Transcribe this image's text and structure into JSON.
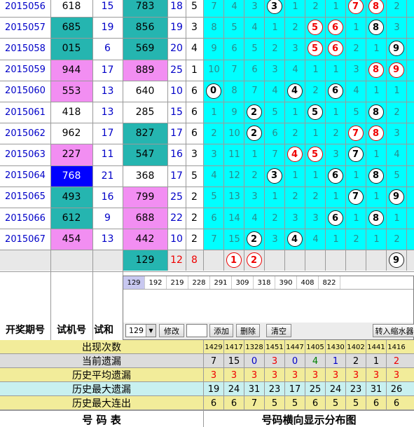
{
  "rows": [
    {
      "period": "2015056",
      "test": "618",
      "ts": "15",
      "num": "783",
      "sum": "18",
      "span": "5",
      "balls": [
        {
          "d": "3",
          "c": "black"
        },
        {
          "d": "7",
          "c": "red"
        },
        {
          "d": "8",
          "c": "red"
        }
      ],
      "misses": [
        "7",
        "4",
        "3",
        "",
        "1",
        "2",
        "1",
        "",
        "",
        "2"
      ]
    },
    {
      "period": "2015057",
      "test": "685",
      "ts": "19",
      "num": "856",
      "sum": "19",
      "span": "3",
      "balls": [
        {
          "d": "5",
          "c": "red"
        },
        {
          "d": "6",
          "c": "red"
        },
        {
          "d": "8",
          "c": "black"
        }
      ],
      "misses": [
        "8",
        "5",
        "4",
        "1",
        "2",
        "",
        "",
        "1",
        "",
        "3"
      ]
    },
    {
      "period": "2015058",
      "test": "015",
      "ts": "6",
      "num": "569",
      "sum": "20",
      "span": "4",
      "balls": [
        {
          "d": "5",
          "c": "red"
        },
        {
          "d": "6",
          "c": "red"
        },
        {
          "d": "9",
          "c": "black"
        }
      ],
      "misses": [
        "9",
        "6",
        "5",
        "2",
        "3",
        "",
        "",
        "2",
        "1",
        ""
      ]
    },
    {
      "period": "2015059",
      "test": "944",
      "ts": "17",
      "num": "889",
      "sum": "25",
      "span": "1",
      "balls": [
        {
          "d": "8",
          "c": "red"
        },
        {
          "d": "9",
          "c": "red"
        }
      ],
      "misses": [
        "10",
        "7",
        "6",
        "3",
        "4",
        "1",
        "1",
        "3",
        "",
        ""
      ]
    },
    {
      "period": "2015060",
      "test": "553",
      "ts": "13",
      "num": "640",
      "sum": "10",
      "span": "6",
      "balls": [
        {
          "d": "0",
          "c": "black"
        },
        {
          "d": "4",
          "c": "black"
        },
        {
          "d": "6",
          "c": "black"
        }
      ],
      "misses": [
        "",
        "8",
        "7",
        "4",
        "",
        "2",
        "",
        "4",
        "1",
        "1"
      ]
    },
    {
      "period": "2015061",
      "test": "418",
      "ts": "13",
      "num": "285",
      "sum": "15",
      "span": "6",
      "balls": [
        {
          "d": "2",
          "c": "black"
        },
        {
          "d": "5",
          "c": "black"
        },
        {
          "d": "8",
          "c": "black"
        }
      ],
      "misses": [
        "1",
        "9",
        "",
        "5",
        "1",
        "",
        "1",
        "5",
        "",
        "2"
      ]
    },
    {
      "period": "2015062",
      "test": "962",
      "ts": "17",
      "num": "827",
      "sum": "17",
      "span": "6",
      "balls": [
        {
          "d": "2",
          "c": "black"
        },
        {
          "d": "7",
          "c": "red"
        },
        {
          "d": "8",
          "c": "red"
        }
      ],
      "misses": [
        "2",
        "10",
        "",
        "6",
        "2",
        "1",
        "2",
        "",
        "",
        "3"
      ]
    },
    {
      "period": "2015063",
      "test": "227",
      "ts": "11",
      "num": "547",
      "sum": "16",
      "span": "3",
      "balls": [
        {
          "d": "4",
          "c": "red"
        },
        {
          "d": "5",
          "c": "red"
        },
        {
          "d": "7",
          "c": "black"
        }
      ],
      "misses": [
        "3",
        "11",
        "1",
        "7",
        "",
        "",
        "3",
        "",
        "1",
        "4"
      ]
    },
    {
      "period": "2015064",
      "test": "768",
      "ts": "21",
      "num": "368",
      "sum": "17",
      "span": "5",
      "balls": [
        {
          "d": "3",
          "c": "black"
        },
        {
          "d": "6",
          "c": "black"
        },
        {
          "d": "8",
          "c": "black"
        }
      ],
      "misses": [
        "4",
        "12",
        "2",
        "",
        "1",
        "1",
        "",
        "1",
        "",
        "5"
      ]
    },
    {
      "period": "2015065",
      "test": "493",
      "ts": "16",
      "num": "799",
      "sum": "25",
      "span": "2",
      "balls": [
        {
          "d": "7",
          "c": "black"
        },
        {
          "d": "9",
          "c": "black"
        }
      ],
      "misses": [
        "5",
        "13",
        "3",
        "1",
        "2",
        "2",
        "1",
        "",
        "1",
        ""
      ]
    },
    {
      "period": "2015066",
      "test": "612",
      "ts": "9",
      "num": "688",
      "sum": "22",
      "span": "2",
      "balls": [
        {
          "d": "6",
          "c": "black"
        },
        {
          "d": "8",
          "c": "black"
        }
      ],
      "misses": [
        "6",
        "14",
        "4",
        "2",
        "3",
        "3",
        "",
        "1",
        "",
        "1"
      ]
    },
    {
      "period": "2015067",
      "test": "454",
      "ts": "13",
      "num": "442",
      "sum": "10",
      "span": "2",
      "balls": [
        {
          "d": "2",
          "c": "black"
        },
        {
          "d": "4",
          "c": "black"
        }
      ],
      "misses": [
        "7",
        "15",
        "",
        "3",
        "",
        "4",
        "1",
        "2",
        "1",
        "2"
      ]
    }
  ],
  "forecast": {
    "num": "129",
    "sum": "12",
    "span": "8",
    "balls": [
      {
        "d": "1",
        "c": "red"
      },
      {
        "d": "2",
        "c": "red"
      },
      {
        "d": "9",
        "c": "black"
      }
    ]
  },
  "panel": {
    "candidates": [
      "129",
      "192",
      "219",
      "228",
      "291",
      "309",
      "318",
      "390",
      "408",
      "822"
    ],
    "select_value": "129",
    "buttons": {
      "modify": "修改",
      "add": "添加",
      "delete": "删除",
      "clear": "清空",
      "export": "转入缩水器"
    }
  },
  "headers": {
    "period": "开奖期号",
    "test": "试机号",
    "test_sum": "试和"
  },
  "stats": {
    "labels": [
      "出现次数",
      "当前遗漏",
      "历史平均遗漏",
      "历史最大遗漏",
      "历史最大连出"
    ],
    "occurrence": [
      "1429",
      "1417",
      "1328",
      "1451",
      "1447",
      "1405",
      "1430",
      "1402",
      "1441",
      "1416"
    ],
    "current": [
      "7",
      "15",
      "0",
      "3",
      "0",
      "4",
      "1",
      "2",
      "1",
      "2"
    ],
    "avg": [
      "3",
      "3",
      "3",
      "3",
      "3",
      "3",
      "3",
      "3",
      "3",
      "3"
    ],
    "max_miss": [
      "19",
      "24",
      "31",
      "23",
      "17",
      "25",
      "24",
      "23",
      "31",
      "26"
    ],
    "max_run": [
      "6",
      "6",
      "7",
      "5",
      "5",
      "6",
      "5",
      "5",
      "6",
      "6"
    ]
  },
  "footer": {
    "left": "号 码 表",
    "right": "号码横向显示分布图"
  },
  "colors": {
    "teal": "#25b5b0",
    "pink": "#f28ef2",
    "blue": "#0000ff",
    "cyan": "#00ffff",
    "period_text": "#0000c8",
    "ball_red": "#ee0000"
  }
}
